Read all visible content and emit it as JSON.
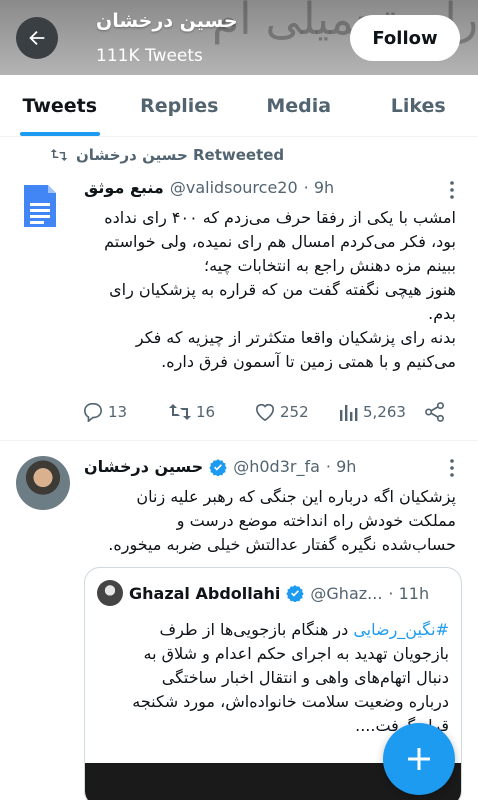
{
  "header": {
    "banner_text": "رای تحمیلی ام",
    "profile_name": "حسین درخشان",
    "tweet_count": "111K Tweets",
    "follow_label": "Follow"
  },
  "tabs": [
    {
      "label": "Tweets",
      "active": true
    },
    {
      "label": "Replies",
      "active": false
    },
    {
      "label": "Media",
      "active": false
    },
    {
      "label": "Likes",
      "active": false
    }
  ],
  "tweet1": {
    "retweet_label": "حسین درخشان Retweeted",
    "name": "منبع موثق",
    "handle": "@validsource20",
    "time": "· 9h",
    "lines": [
      "امشب با یکی از رفقا حرف می‌زدم که ۴۰۰ رای نداده",
      "بود، فکر می‌کردم امسال هم رای نمیده، ولی خواستم",
      "ببینم مزه دهنش راجع به انتخابات چیه؛",
      "هنوز هیچی نگفته گفت من که قراره به پزشکیان رای",
      "بدم.",
      "بدنه رای پزشکیان واقعا متکثرتر از چیزیه که فکر",
      "می‌کنیم و با همتی زمین تا آسمون فرق داره."
    ],
    "stats": {
      "replies": "13",
      "retweets": "16",
      "likes": "252",
      "views": "5,263"
    }
  },
  "tweet2": {
    "name": "حسین درخشان",
    "handle": "@h0d3r_fa",
    "time": "· 9h",
    "lines": [
      "پزشکیان اگه درباره این جنگی که رهبر علیه زنان",
      "مملکت خودش راه انداخته موضع درست و",
      "حساب‌شده نگیره گفتار عدالتش خیلی ضربه میخوره."
    ],
    "quote": {
      "name": "Ghazal Abdollahi",
      "handle": "@Ghaz...",
      "time": "· 11h",
      "hashtag": "#نگین_رضایی",
      "lines": [
        "در هنگام بازجویی‌ها از طرف",
        "بازجویان تهدید به اجرای حکم اعدام و شلاق به",
        "دنبال اتهام‌های واهی و انتقال اخبار ساختگی",
        "درباره وضعیت سلامت خانواده‌اش، مورد شکنجه",
        "قرار گرفت...."
      ]
    }
  },
  "colors": {
    "accent": "#1d9bf0",
    "text": "#0f1419",
    "muted": "#536471",
    "verified": "#1d9bf0"
  }
}
